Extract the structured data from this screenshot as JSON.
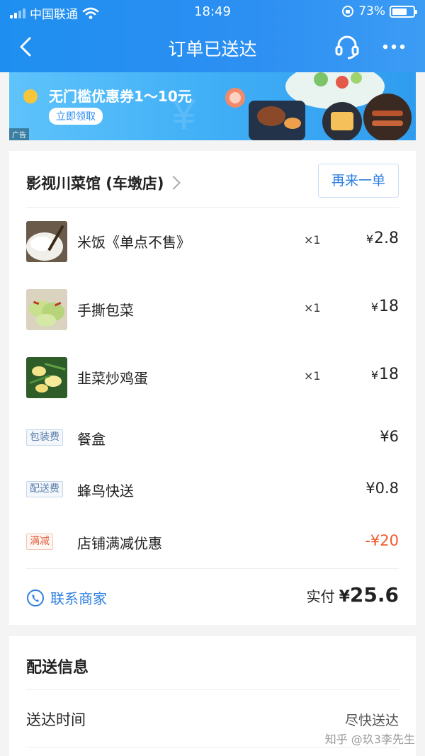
{
  "status_bar": {
    "carrier": "中国联通",
    "time": "18:49",
    "battery_percent": "73%",
    "battery_level": 0.73
  },
  "nav": {
    "title": "订单已送达"
  },
  "banner": {
    "subtitle": "无门槛优惠券1～10元",
    "button_label": "立即领取",
    "ad_label": "广告"
  },
  "order": {
    "shop_name": "影视川菜馆 (车墩店)",
    "reorder_label": "再来一单",
    "items": [
      {
        "name": "米饭《单点不售》",
        "qty": "×1",
        "currency": "¥",
        "price": "2.8"
      },
      {
        "name": "手撕包菜",
        "qty": "×1",
        "currency": "¥",
        "price": "18"
      },
      {
        "name": "韭菜炒鸡蛋",
        "qty": "×1",
        "currency": "¥",
        "price": "18"
      }
    ],
    "fees": [
      {
        "tag": "包装费",
        "name": "餐盒",
        "price": "¥6"
      },
      {
        "tag": "配送费",
        "name": "蜂鸟快送",
        "price": "¥0.8"
      },
      {
        "tag": "满减",
        "name": "店铺满减优惠",
        "price": "-¥20"
      }
    ],
    "contact_label": "联系商家",
    "paid_label": "实付",
    "paid_currency": "¥",
    "paid_amount": "25.6"
  },
  "delivery": {
    "title": "配送信息",
    "time_label": "送达时间",
    "time_value": "尽快送达"
  },
  "watermark": "知乎 @玖3李先生",
  "colors": {
    "header": "#2d8ff2",
    "accent_blue": "#2f7fe0",
    "discount_red": "#f05a2b"
  }
}
